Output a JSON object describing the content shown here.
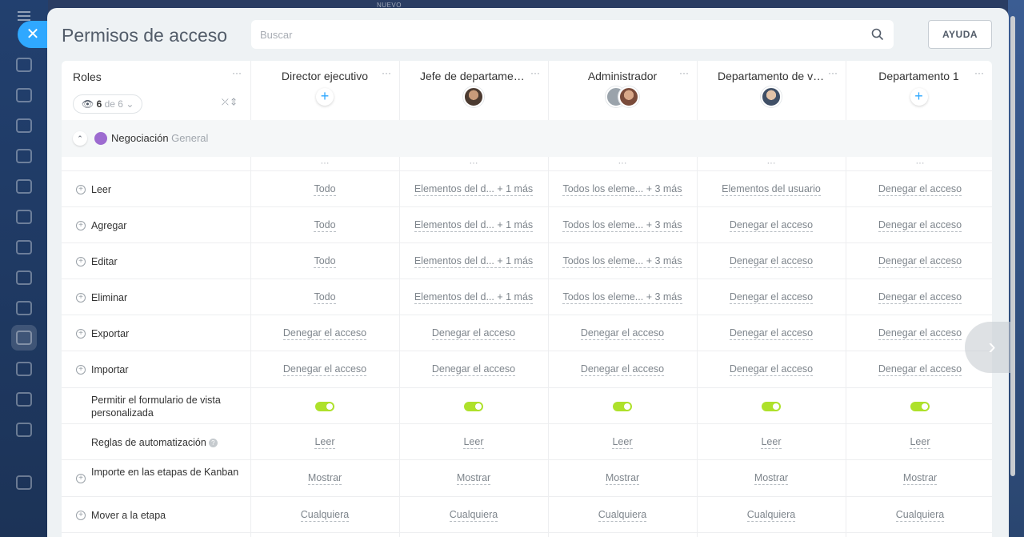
{
  "backdrop": {
    "badge": "NUEVO"
  },
  "panel": {
    "title": "Permisos de acceso",
    "search_placeholder": "Buscar",
    "help_label": "AYUDA"
  },
  "roles": {
    "label": "Roles",
    "counter_shown": "6",
    "counter_of": "de 6"
  },
  "columns": [
    {
      "name": "Director ejecutivo",
      "assigned": "add"
    },
    {
      "name": "Jefe de departamento",
      "assigned": "avatar"
    },
    {
      "name": "Administrador",
      "assigned": "avatar-group"
    },
    {
      "name": "Departamento de ventas",
      "assigned": "avatar"
    },
    {
      "name": "Departamento 1",
      "assigned": "add"
    }
  ],
  "section": {
    "name": "Negociación",
    "sub": "General",
    "icon": "deal-icon"
  },
  "rows": [
    {
      "label": "Leer",
      "expandable": true,
      "values": [
        "Todo",
        "Elementos del d... + 1 más",
        "Todos los eleme... + 3 más",
        "Elementos del usuario",
        "Denegar el acceso"
      ]
    },
    {
      "label": "Agregar",
      "expandable": true,
      "values": [
        "Todo",
        "Elementos del d... + 1 más",
        "Todos los eleme... + 3 más",
        "Denegar el acceso",
        "Denegar el acceso"
      ]
    },
    {
      "label": "Editar",
      "expandable": true,
      "values": [
        "Todo",
        "Elementos del d... + 1 más",
        "Todos los eleme... + 3 más",
        "Denegar el acceso",
        "Denegar el acceso"
      ]
    },
    {
      "label": "Eliminar",
      "expandable": true,
      "values": [
        "Todo",
        "Elementos del d... + 1 más",
        "Todos los eleme... + 3 más",
        "Denegar el acceso",
        "Denegar el acceso"
      ]
    },
    {
      "label": "Exportar",
      "expandable": true,
      "values": [
        "Denegar el acceso",
        "Denegar el acceso",
        "Denegar el acceso",
        "Denegar el acceso",
        "Denegar el acceso"
      ]
    },
    {
      "label": "Importar",
      "expandable": true,
      "values": [
        "Denegar el acceso",
        "Denegar el acceso",
        "Denegar el acceso",
        "Denegar el acceso",
        "Denegar el acceso"
      ]
    },
    {
      "label": "Permitir el formulario de vista personalizada",
      "expandable": false,
      "toggle": [
        true,
        true,
        true,
        true,
        true
      ]
    },
    {
      "label": "Reglas de automatización",
      "expandable": false,
      "help": true,
      "values": [
        "Leer",
        "Leer",
        "Leer",
        "Leer",
        "Leer"
      ]
    },
    {
      "label": "Importe en las etapas de Kanban",
      "expandable": true,
      "values": [
        "Mostrar",
        "Mostrar",
        "Mostrar",
        "Mostrar",
        "Mostrar"
      ]
    },
    {
      "label": "Mover a la etapa",
      "expandable": true,
      "values": [
        "Cualquiera",
        "Cualquiera",
        "Cualquiera",
        "Cualquiera",
        "Cualquiera"
      ]
    }
  ],
  "colors": {
    "accent": "#2fa8ff",
    "toggle_on": "#aee12b",
    "section_icon": "#9d6bd0"
  }
}
